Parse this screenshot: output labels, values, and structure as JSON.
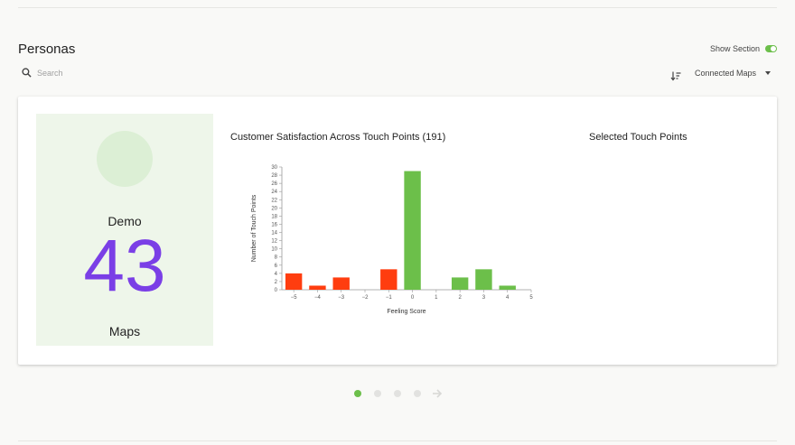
{
  "section": {
    "title": "Personas",
    "show_section_label": "Show Section",
    "show_section_on": true
  },
  "search": {
    "placeholder": "Search",
    "value": ""
  },
  "filter": {
    "selected": "Connected Maps"
  },
  "persona": {
    "name": "Demo",
    "count": "43",
    "unit": "Maps",
    "avatar_color": "#dcefd5",
    "accent": "#7a3fe6"
  },
  "chart_title": "Customer Satisfaction Across Touch Points (191)",
  "selected_title": "Selected Touch Points",
  "colors": {
    "negative": "#ff3d0f",
    "positive": "#6cbf4a",
    "toggle": "#6cbf4a"
  },
  "chart_data": {
    "type": "bar",
    "xlabel": "Feeling Score",
    "ylabel": "Number of Touch Points",
    "xlim": [
      -5.5,
      5
    ],
    "ylim": [
      0,
      30
    ],
    "x_ticks": [
      {
        "value": -5,
        "label": "−5"
      },
      {
        "value": -4,
        "label": "−4"
      },
      {
        "value": -3,
        "label": "−3"
      },
      {
        "value": -2,
        "label": "−2"
      },
      {
        "value": -1,
        "label": "−1"
      },
      {
        "value": 0,
        "label": "0"
      },
      {
        "value": 1,
        "label": "1"
      },
      {
        "value": 2,
        "label": "2"
      },
      {
        "value": 3,
        "label": "3"
      },
      {
        "value": 4,
        "label": "4"
      },
      {
        "value": 5,
        "label": "5"
      }
    ],
    "y_ticks": [
      0,
      2,
      4,
      6,
      8,
      10,
      12,
      14,
      16,
      18,
      20,
      22,
      24,
      26,
      28,
      30
    ],
    "bars": [
      {
        "x": -5,
        "y": 4
      },
      {
        "x": -4,
        "y": 1
      },
      {
        "x": -3,
        "y": 3
      },
      {
        "x": -1,
        "y": 5
      },
      {
        "x": 0,
        "y": 29
      },
      {
        "x": 2,
        "y": 3
      },
      {
        "x": 3,
        "y": 5
      },
      {
        "x": 4,
        "y": 1
      }
    ]
  },
  "pager": {
    "pages": 4,
    "active": 0
  }
}
